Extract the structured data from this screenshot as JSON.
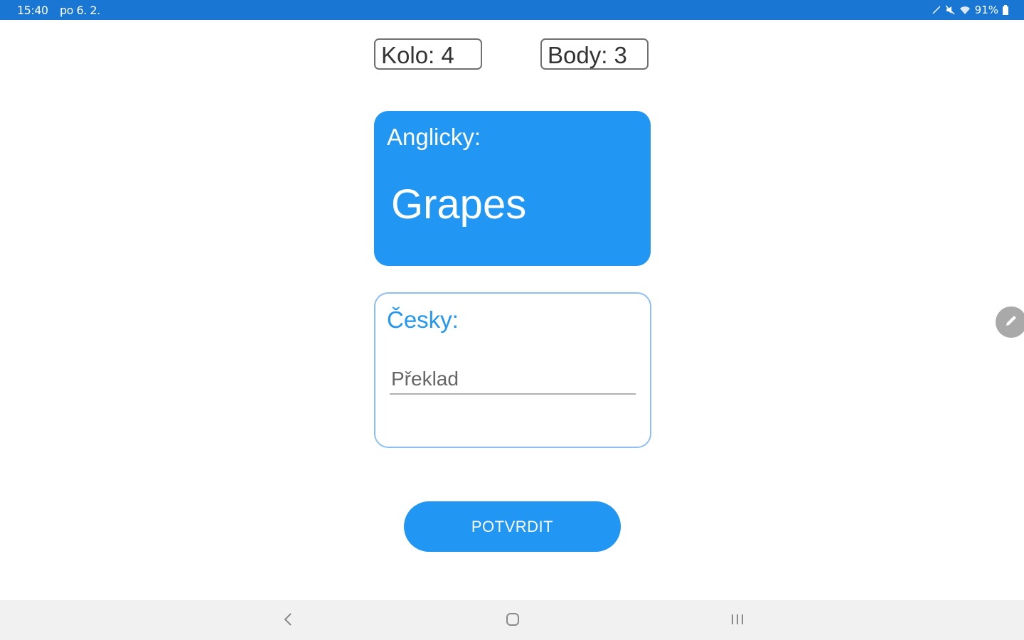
{
  "status_bar": {
    "time": "15:40",
    "date": "po 6. 2.",
    "battery": "91%",
    "icons": [
      "pen-icon",
      "mute-icon",
      "wifi-icon",
      "battery-icon"
    ]
  },
  "counters": {
    "round": "Kolo: 4",
    "score": "Body: 3"
  },
  "english_card": {
    "label": "Anglicky:",
    "word": "Grapes"
  },
  "czech_card": {
    "label": "Česky:",
    "input_value": "",
    "input_placeholder": "Překlad"
  },
  "confirm_button": {
    "label": "POTVRDIT"
  },
  "edge_panel": {
    "icon": "pencil-icon"
  },
  "nav_bar": {
    "icons": [
      "back-icon",
      "home-icon",
      "recents-icon"
    ]
  },
  "colors": {
    "status_bar": "#1976d2",
    "accent": "#2196f3",
    "nav_bar": "#f1f1f1"
  }
}
